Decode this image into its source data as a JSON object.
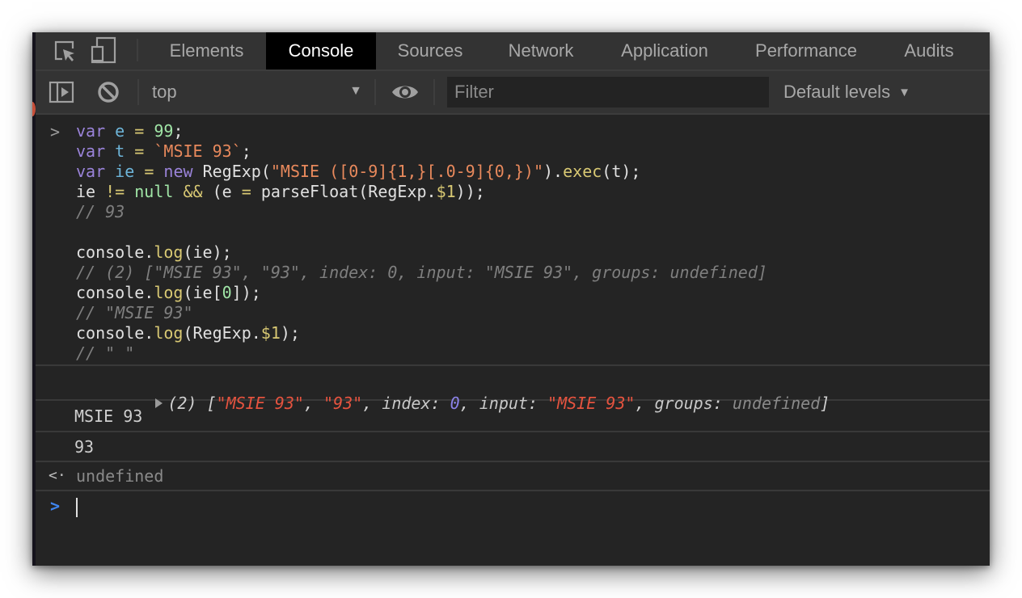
{
  "devtools": {
    "tabs": [
      {
        "label": "Elements",
        "active": false
      },
      {
        "label": "Console",
        "active": true
      },
      {
        "label": "Sources",
        "active": false
      },
      {
        "label": "Network",
        "active": false
      },
      {
        "label": "Application",
        "active": false
      },
      {
        "label": "Performance",
        "active": false
      },
      {
        "label": "Audits",
        "active": false
      }
    ],
    "icons": {
      "inspect": "inspect-element-icon",
      "device": "device-toolbar-icon",
      "sidebar": "show-sidebar-icon",
      "clear": "clear-console-icon",
      "eye": "live-expression-icon"
    }
  },
  "toolbar": {
    "context": "top",
    "context_arrow": "▼",
    "filter_placeholder": "Filter",
    "filter_value": "",
    "levels_label": "Default levels",
    "levels_arrow": "▼"
  },
  "input": {
    "prompt": ">",
    "lines": [
      [
        [
          "kw",
          "var"
        ],
        [
          "txt",
          " "
        ],
        [
          "var",
          "e"
        ],
        [
          "txt",
          " "
        ],
        [
          "op",
          "="
        ],
        [
          "txt",
          " "
        ],
        [
          "num",
          "99"
        ],
        [
          "txt",
          ";"
        ]
      ],
      [
        [
          "kw",
          "var"
        ],
        [
          "txt",
          " "
        ],
        [
          "var",
          "t"
        ],
        [
          "txt",
          " "
        ],
        [
          "op",
          "="
        ],
        [
          "txt",
          " "
        ],
        [
          "str",
          "`MSIE 93`"
        ],
        [
          "txt",
          ";"
        ]
      ],
      [
        [
          "kw",
          "var"
        ],
        [
          "txt",
          " "
        ],
        [
          "var",
          "ie"
        ],
        [
          "txt",
          " "
        ],
        [
          "op",
          "="
        ],
        [
          "txt",
          " "
        ],
        [
          "kw",
          "new"
        ],
        [
          "txt",
          " RegExp("
        ],
        [
          "str",
          "\"MSIE ([0-9]{1,}[.0-9]{0,})\""
        ],
        [
          "txt",
          ")."
        ],
        [
          "fn",
          "exec"
        ],
        [
          "txt",
          "(t);"
        ]
      ],
      [
        [
          "txt",
          "ie "
        ],
        [
          "op",
          "!="
        ],
        [
          "txt",
          " "
        ],
        [
          "num",
          "null"
        ],
        [
          "txt",
          " "
        ],
        [
          "op",
          "&&"
        ],
        [
          "txt",
          " (e "
        ],
        [
          "op",
          "="
        ],
        [
          "txt",
          " parseFloat(RegExp."
        ],
        [
          "fn",
          "$1"
        ],
        [
          "txt",
          "));"
        ]
      ],
      [
        [
          "cmt",
          "// 93"
        ]
      ],
      [
        [
          "txt",
          ""
        ]
      ],
      [
        [
          "txt",
          "console."
        ],
        [
          "fn",
          "log"
        ],
        [
          "txt",
          "(ie);"
        ]
      ],
      [
        [
          "cmt",
          "// (2) [\"MSIE 93\", \"93\", index: 0, input: \"MSIE 93\", groups: undefined]"
        ]
      ],
      [
        [
          "txt",
          "console."
        ],
        [
          "fn",
          "log"
        ],
        [
          "txt",
          "(ie["
        ],
        [
          "num",
          "0"
        ],
        [
          "txt",
          "]);"
        ]
      ],
      [
        [
          "cmt",
          "// \"MSIE 93\""
        ]
      ],
      [
        [
          "txt",
          "console."
        ],
        [
          "fn",
          "log"
        ],
        [
          "txt",
          "(RegExp."
        ],
        [
          "fn",
          "$1"
        ],
        [
          "txt",
          ");"
        ]
      ],
      [
        [
          "cmt",
          "// \" \""
        ]
      ]
    ]
  },
  "outputs": {
    "array_log": [
      [
        "o-punct",
        "(2) ["
      ],
      [
        "o-str",
        "\"MSIE 93\""
      ],
      [
        "o-punct",
        ", "
      ],
      [
        "o-str",
        "\"93\""
      ],
      [
        "o-punct",
        ", "
      ],
      [
        "o-key",
        "index"
      ],
      [
        "o-punct",
        ": "
      ],
      [
        "o-num",
        "0"
      ],
      [
        "o-punct",
        ", "
      ],
      [
        "o-key",
        "input"
      ],
      [
        "o-punct",
        ": "
      ],
      [
        "o-str",
        "\"MSIE 93\""
      ],
      [
        "o-punct",
        ", "
      ],
      [
        "o-key",
        "groups"
      ],
      [
        "o-punct",
        ": "
      ],
      [
        "o-undef",
        "undefined"
      ],
      [
        "o-punct",
        "]"
      ]
    ],
    "log_1": "MSIE 93",
    "log_2": "93",
    "result_prompt": "<·",
    "result": "undefined",
    "new_prompt": ">"
  }
}
